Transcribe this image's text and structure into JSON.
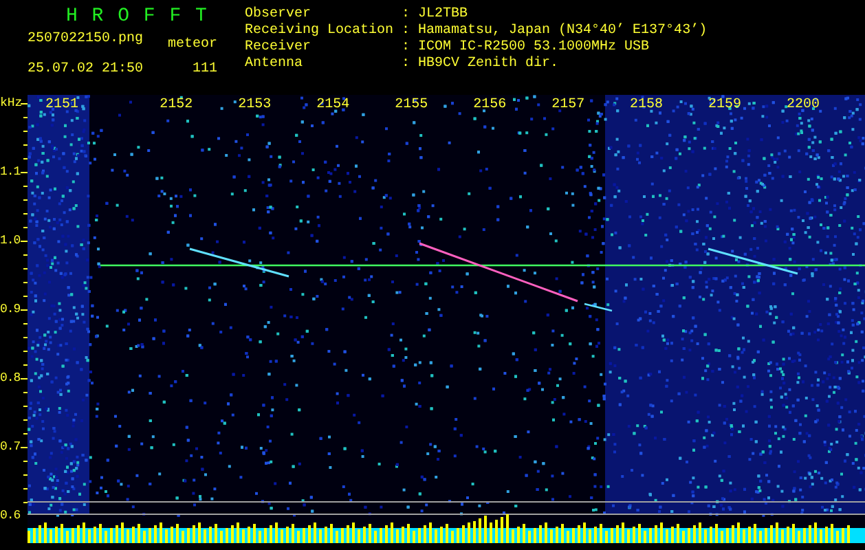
{
  "app_title": "H R O F F T",
  "file_name": "2507022150.png",
  "mode": "meteor",
  "timestamp": "25.07.02 21:50",
  "count": "111",
  "info": [
    {
      "label": "Observer",
      "separator": ":",
      "value": "JL2TBB"
    },
    {
      "label": "Receiving Location",
      "separator": ":",
      "value": "Hamamatsu, Japan (N34°40’ E137°43’)"
    },
    {
      "label": "Receiver",
      "separator": ":",
      "value": "ICOM IC-R2500 53.1000MHz USB"
    },
    {
      "label": "Antenna",
      "separator": ":",
      "value": "HB9CV Zenith dir."
    }
  ],
  "spectrogram": {
    "y_unit": "kHz",
    "x_labels": [
      "2151",
      "2152",
      "2153",
      "2154",
      "2155",
      "2156",
      "2157",
      "2158",
      "2159",
      "2200"
    ],
    "y_labels": [
      "1.1",
      "1.0",
      "0.9",
      "0.8",
      "0.7",
      "0.6"
    ]
  }
}
